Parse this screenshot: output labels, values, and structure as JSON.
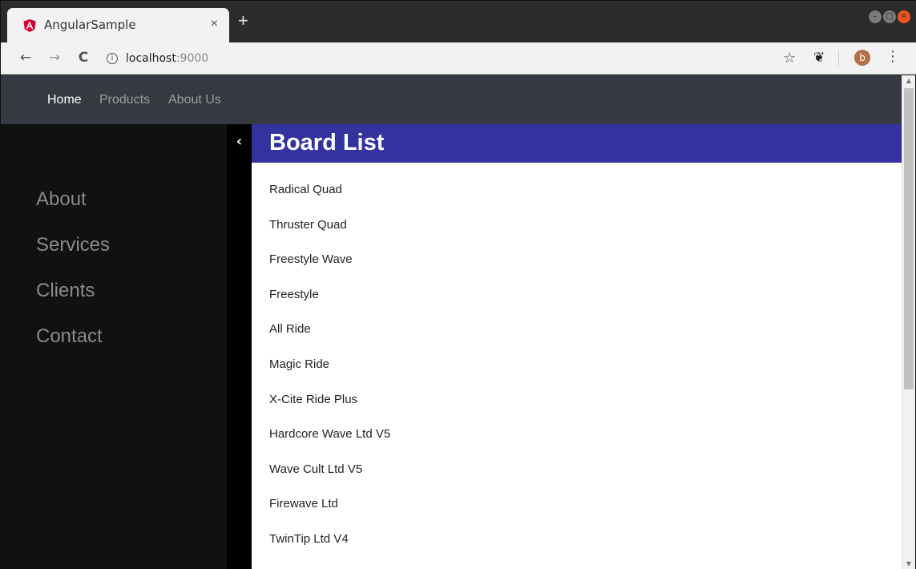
{
  "browser": {
    "tab": {
      "title": "AngularSample",
      "favicon_icon": "angular-logo-icon",
      "close_label": "×"
    },
    "new_tab_label": "+",
    "toolbar": {
      "back_label": "←",
      "forward_label": "→",
      "reload_label": "C",
      "info_label": "i",
      "url_host": "localhost",
      "url_port": ":9000",
      "bookmark_label": "☆",
      "extension_label": "❦",
      "profile_initial": "b",
      "menu_label": "⋮"
    },
    "window_controls": {
      "minimize": "–",
      "maximize": "□",
      "close": "×"
    },
    "colors": {
      "close": "#e95420",
      "profile": "#b0704a"
    }
  },
  "navbar": {
    "links": [
      {
        "label": "Home",
        "active": true
      },
      {
        "label": "Products",
        "active": false
      },
      {
        "label": "About Us",
        "active": false
      }
    ]
  },
  "sidenav": {
    "items": [
      "About",
      "Services",
      "Clients",
      "Contact"
    ],
    "collapse_label": "‹"
  },
  "main": {
    "title": "Board List",
    "header_color": "#3333a0",
    "boards": [
      "Radical Quad",
      "Thruster Quad",
      "Freestyle Wave",
      "Freestyle",
      "All Ride",
      "Magic Ride",
      "X-Cite Ride Plus",
      "Hardcore Wave Ltd V5",
      "Wave Cult Ltd V5",
      "Firewave Ltd",
      "TwinTip Ltd V4"
    ]
  },
  "scrollbar": {
    "up_label": "▲",
    "down_label": "▼"
  }
}
